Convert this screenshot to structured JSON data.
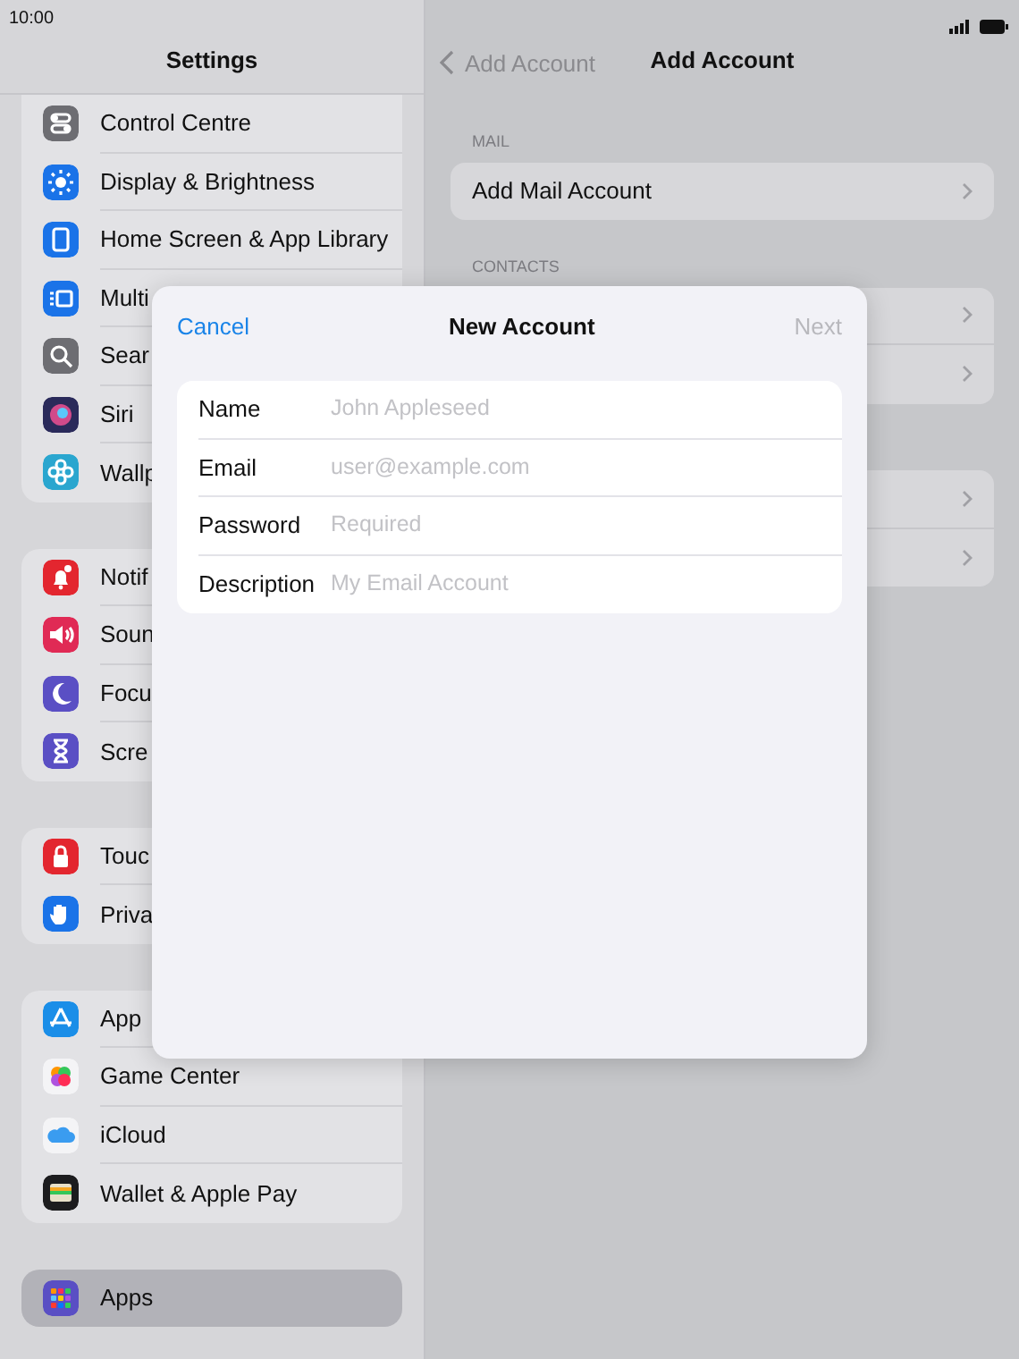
{
  "status_bar": {
    "time": "10:00"
  },
  "sidebar": {
    "title": "Settings",
    "groups": [
      [
        {
          "label": "Control Centre",
          "kind": "toggles",
          "color": "#6d6d72",
          "selected": false
        },
        {
          "label": "Display & Brightness",
          "kind": "sun",
          "color": "#1a73e8",
          "selected": false
        },
        {
          "label": "Home Screen & App Library",
          "kind": "phone",
          "color": "#1a73e8",
          "selected": false
        },
        {
          "label": "Multi",
          "kind": "multitask",
          "color": "#1a73e8",
          "selected": false
        },
        {
          "label": "Sear",
          "kind": "search",
          "color": "#6d6d72",
          "selected": false
        },
        {
          "label": "Siri",
          "kind": "orb",
          "color": "#2a2a5a",
          "selected": false
        },
        {
          "label": "Wallp",
          "kind": "flower",
          "color": "#2aa6cf",
          "selected": false
        }
      ],
      [
        {
          "label": "Notif",
          "kind": "bell",
          "color": "#e3262f",
          "selected": false
        },
        {
          "label": "Soun",
          "kind": "speaker",
          "color": "#e02a55",
          "selected": false
        },
        {
          "label": "Focu",
          "kind": "moon",
          "color": "#5a4fc4",
          "selected": false
        },
        {
          "label": "Scre",
          "kind": "hourglass",
          "color": "#5a4fc4",
          "selected": false
        }
      ],
      [
        {
          "label": "Touc",
          "kind": "lock",
          "color": "#e3262f",
          "selected": false
        },
        {
          "label": "Priva",
          "kind": "hand",
          "color": "#1a73e8",
          "selected": false
        }
      ],
      [
        {
          "label": "App",
          "kind": "appstore",
          "color": "#1a8ee8",
          "selected": false
        },
        {
          "label": "Game Center",
          "kind": "bubbles",
          "color": "#f4f4f6",
          "selected": false
        },
        {
          "label": "iCloud",
          "kind": "cloud",
          "color": "#f4f4f6",
          "selected": false
        },
        {
          "label": "Wallet & Apple Pay",
          "kind": "wallet",
          "color": "#1c1c1e",
          "selected": false
        }
      ],
      [
        {
          "label": "Apps",
          "kind": "grid",
          "color": "#5a4fc4",
          "selected": true
        }
      ]
    ]
  },
  "detail": {
    "back": "Add Account",
    "title": "Add Account",
    "sections": [
      {
        "header": "MAIL",
        "rows": [
          {
            "label": "Add Mail Account"
          }
        ]
      },
      {
        "header": "CONTACTS",
        "rows": [
          {},
          {}
        ]
      },
      {
        "rows": [
          {},
          {}
        ]
      }
    ]
  },
  "modal": {
    "cancel": "Cancel",
    "title": "New Account",
    "next": "Next",
    "next_disabled": true,
    "fields": [
      {
        "label": "Name",
        "placeholder": "John Appleseed"
      },
      {
        "label": "Email",
        "placeholder": "user@example.com"
      },
      {
        "label": "Password",
        "placeholder": "Required"
      },
      {
        "label": "Description",
        "placeholder": "My Email Account"
      }
    ]
  }
}
